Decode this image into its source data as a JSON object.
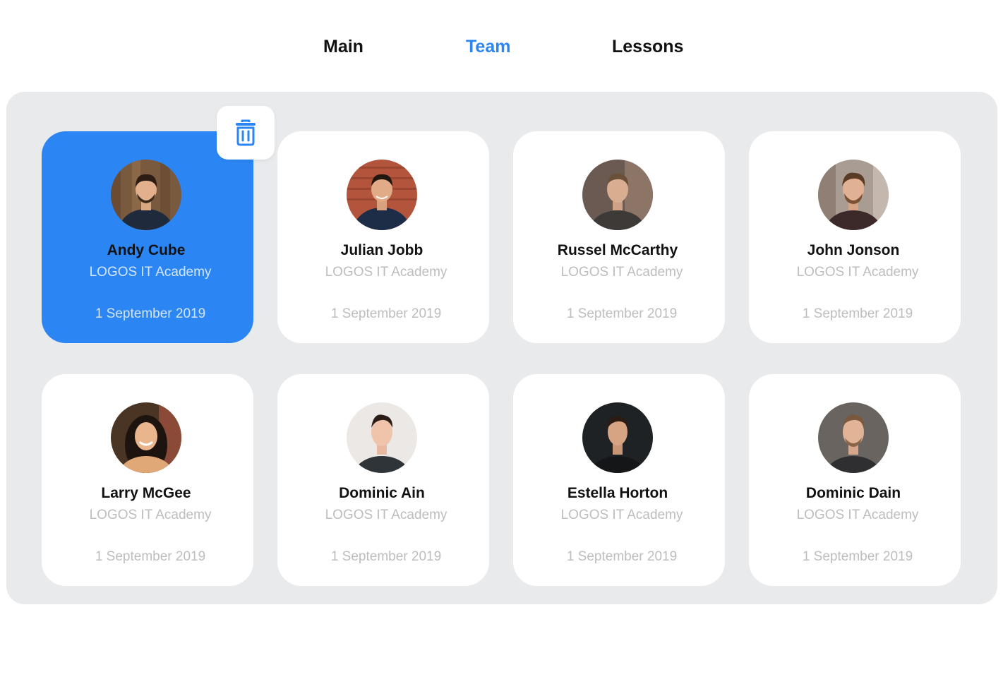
{
  "nav": {
    "items": [
      {
        "label": "Main",
        "active": false
      },
      {
        "label": "Team",
        "active": true
      },
      {
        "label": "Lessons",
        "active": false
      }
    ]
  },
  "colors": {
    "accent": "#2b86f3",
    "panel_bg": "#e9eaec",
    "muted_text": "#bdbdbd"
  },
  "delete_button": {
    "icon": "trash-icon"
  },
  "team": [
    {
      "name": "Andy Cube",
      "org": "LOGOS IT Academy",
      "date": "1 September 2019",
      "selected": true,
      "avatar": "man-beard-wood-bg"
    },
    {
      "name": "Julian Jobb",
      "org": "LOGOS IT Academy",
      "date": "1 September 2019",
      "selected": false,
      "avatar": "man-brick-bg"
    },
    {
      "name": "Russel McCarthy",
      "org": "LOGOS IT Academy",
      "date": "1 September 2019",
      "selected": false,
      "avatar": "man-serious"
    },
    {
      "name": "John Jonson",
      "org": "LOGOS IT Academy",
      "date": "1 September 2019",
      "selected": false,
      "avatar": "man-beard-city-bg"
    },
    {
      "name": "Larry McGee",
      "org": "LOGOS IT Academy",
      "date": "1 September 2019",
      "selected": false,
      "avatar": "woman-smiling"
    },
    {
      "name": "Dominic Ain",
      "org": "LOGOS IT Academy",
      "date": "1 September 2019",
      "selected": false,
      "avatar": "man-light-bg"
    },
    {
      "name": "Estella Horton",
      "org": "LOGOS IT Academy",
      "date": "1 September 2019",
      "selected": false,
      "avatar": "man-dark-bg"
    },
    {
      "name": "Dominic Dain",
      "org": "LOGOS IT Academy",
      "date": "1 September 2019",
      "selected": false,
      "avatar": "man-gray-bg"
    }
  ]
}
